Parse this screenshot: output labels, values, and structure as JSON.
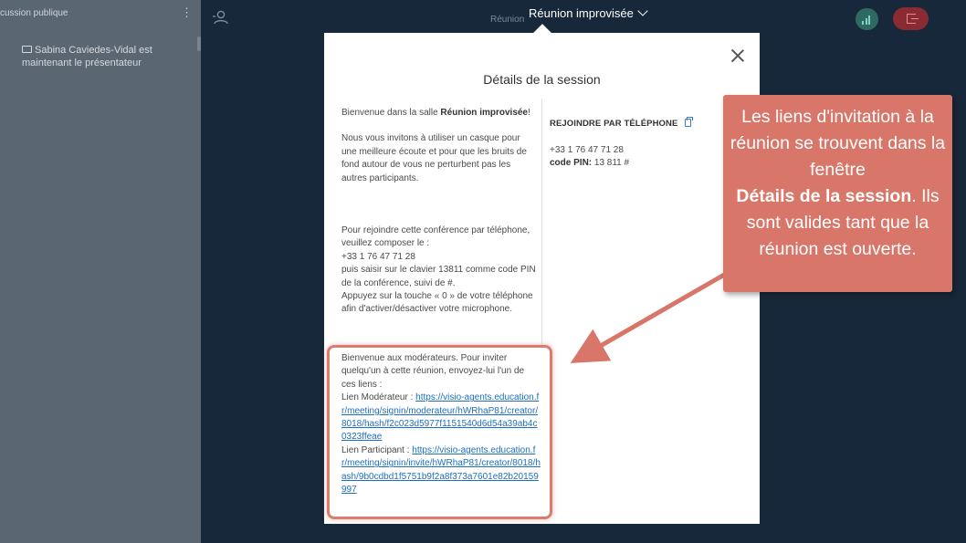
{
  "sidebar": {
    "title": "cussion publique",
    "message": "Sabina Caviedes-Vidal est maintenant le présentateur"
  },
  "header": {
    "background_title": "Réunion",
    "meeting_title": "Réunion improvisée"
  },
  "modal": {
    "title": "Détails de la session",
    "welcome_prefix": "Bienvenue dans la salle ",
    "welcome_room": "Réunion improvisée",
    "welcome_suffix": "!",
    "headset_text": "Nous vous invitons à utiliser un casque pour une meilleure écoute et pour que les bruits de fond autour de vous ne perturbent pas les autres participants.",
    "phone_instructions": "Pour rejoindre cette conférence par téléphone, veuillez composer le :",
    "phone_number_line": "+33 1 76 47 71 28",
    "pin_instructions": "puis saisir sur le clavier 13811 comme code PIN de la conférence, suivi de #.",
    "mute_instructions": "Appuyez sur la touche « 0 » de votre téléphone afin d'activer/désactiver votre microphone.",
    "phone_section": {
      "heading": "REJOINDRE PAR TÉLÉPHONE",
      "number": "+33 1 76 47 71 28",
      "pin_label": "code PIN:",
      "pin_value": " 13 811 #"
    },
    "moderator": {
      "intro": "Bienvenue aux modérateurs. Pour inviter quelqu'un à cette réunion, envoyez-lui l'un de ces liens :",
      "moderator_label": "Lien Modérateur  : ",
      "moderator_link": "https://visio-agents.education.fr/meeting/signin/moderateur/hWRhaP81/creator/8018/hash/f2c023d5977f1151540d6d54a39ab4c0323ffeae",
      "participant_label": "Lien Participant  : ",
      "participant_link": "https://visio-agents.education.fr/meeting/signin/invite/hWRhaP81/creator/8018/hash/9b0cdbd1f5751b9f2a8f373a7601e82b20159997"
    }
  },
  "callout": {
    "line_pre": "Les liens d'invitation à la réunion se trouvent dans la fenêtre",
    "line_bold": "Détails de la session",
    "line_post": ". Ils sont valides tant que la réunion est ouverte."
  },
  "colors": {
    "accent": "#d9766a",
    "link": "#1e6fbf",
    "background": "#17283b",
    "sidebar": "#5b6673"
  }
}
